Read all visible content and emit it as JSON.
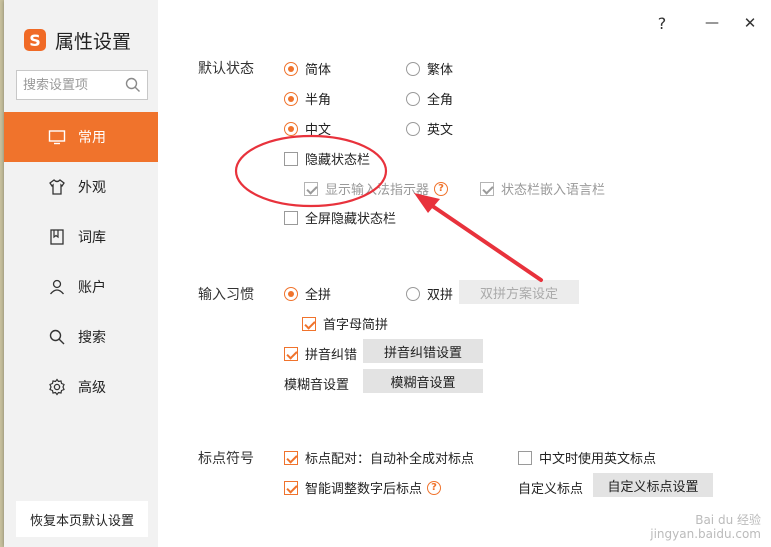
{
  "brand": {
    "title": "属性设置",
    "logo": "S"
  },
  "search": {
    "placeholder": "搜索设置项"
  },
  "nav": {
    "items": [
      {
        "label": "常用",
        "icon": "monitor-icon"
      },
      {
        "label": "外观",
        "icon": "shirt-icon"
      },
      {
        "label": "词库",
        "icon": "book-icon"
      },
      {
        "label": "账户",
        "icon": "user-icon"
      },
      {
        "label": "搜索",
        "icon": "search-icon"
      },
      {
        "label": "高级",
        "icon": "gear-icon"
      }
    ],
    "active": 0
  },
  "restore_label": "恢复本页默认设置",
  "controls": {
    "help": "?",
    "minimize": "—",
    "close": "✕"
  },
  "default_state": {
    "label": "默认状态",
    "simplified": "简体",
    "traditional": "繁体",
    "halfwidth": "半角",
    "fullwidth": "全角",
    "chinese": "中文",
    "english": "英文",
    "hide_status_bar": "隐藏状态栏",
    "show_indicator": "显示输入法指示器",
    "embed_lang_bar": "状态栏嵌入语言栏",
    "fullscreen_hide": "全屏隐藏状态栏"
  },
  "input_habit": {
    "label": "输入习惯",
    "quanpin": "全拼",
    "shuangpin": "双拼",
    "shuangpin_scheme_btn": "双拼方案设定",
    "initial_abbrev": "首字母简拼",
    "pinyin_correction": "拼音纠错",
    "pinyin_correction_btn": "拼音纠错设置",
    "fuzzy_label": "模糊音设置",
    "fuzzy_btn": "模糊音设置"
  },
  "punctuation": {
    "label": "标点符号",
    "pairing": "标点配对：自动补全成对标点",
    "english_punct_in_chinese": "中文时使用英文标点",
    "smart_after_digits": "智能调整数字后标点",
    "custom_label": "自定义标点",
    "custom_btn": "自定义标点设置"
  },
  "watermark": {
    "line1": "Bai du 经验",
    "line2": "jingyan.baidu.com"
  },
  "colors": {
    "accent": "#f0732c",
    "annotation": "#e8323c"
  }
}
